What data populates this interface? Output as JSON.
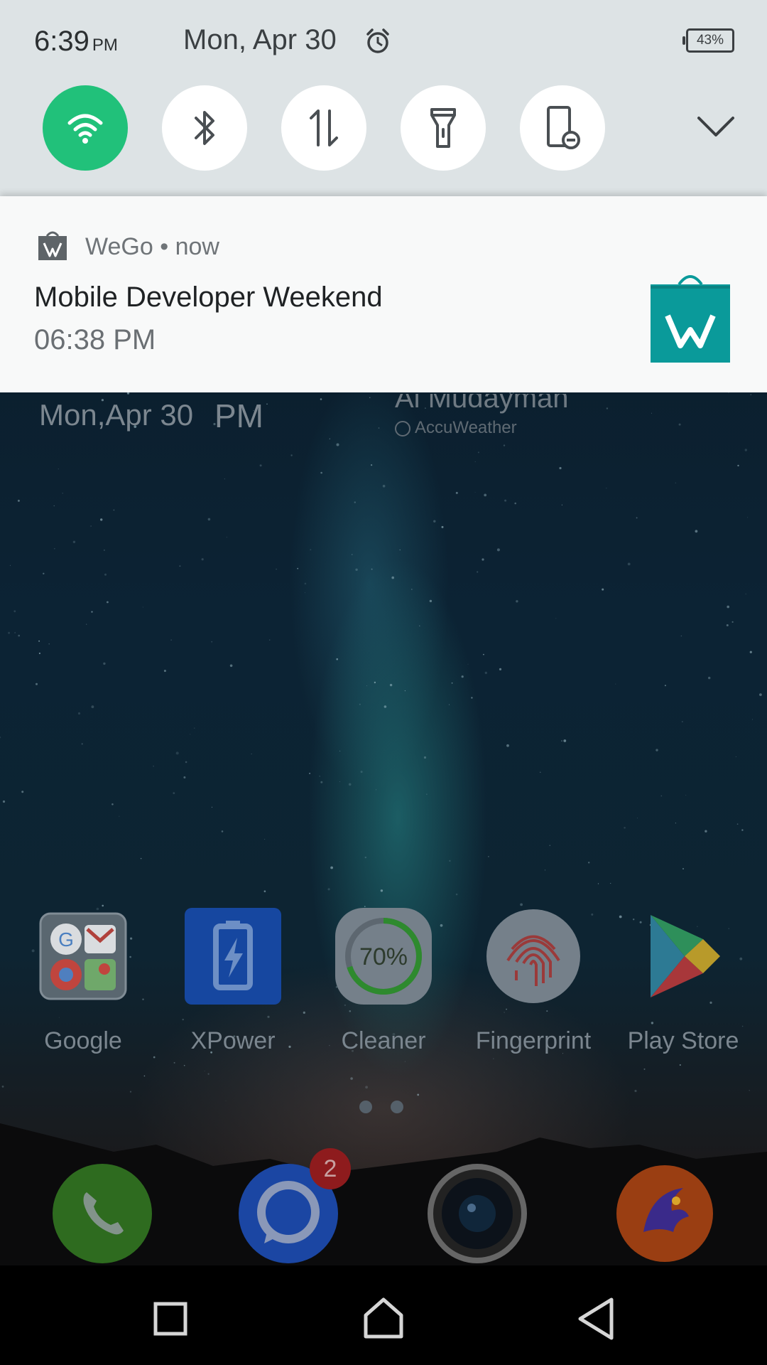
{
  "status_bar": {
    "time": "6:39",
    "ampm": "PM",
    "date": "Mon, Apr 30",
    "battery": "43%"
  },
  "quick_settings": {
    "tiles": [
      {
        "name": "wifi-icon",
        "active": true
      },
      {
        "name": "bluetooth-icon",
        "active": false
      },
      {
        "name": "mobile-data-icon",
        "active": false
      },
      {
        "name": "flashlight-icon",
        "active": false
      },
      {
        "name": "rotation-lock-icon",
        "active": false
      }
    ],
    "accent": "#21c17a"
  },
  "notification": {
    "app_name": "WeGo",
    "separator": "•",
    "time": "now",
    "title": "Mobile Developer Weekend",
    "text": "06:38 PM",
    "icon_color": "#0a9a9a"
  },
  "home": {
    "clock_date": "Mon,Apr 30",
    "clock_ampm": "PM",
    "weather_location": "Al Mudaymah",
    "weather_provider": "AccuWeather",
    "apps": [
      {
        "label": "Google"
      },
      {
        "label": "XPower"
      },
      {
        "label": "Cleaner",
        "percent": "70%"
      },
      {
        "label": "Fingerprint"
      },
      {
        "label": "Play Store"
      }
    ],
    "messages_badge": "2"
  }
}
